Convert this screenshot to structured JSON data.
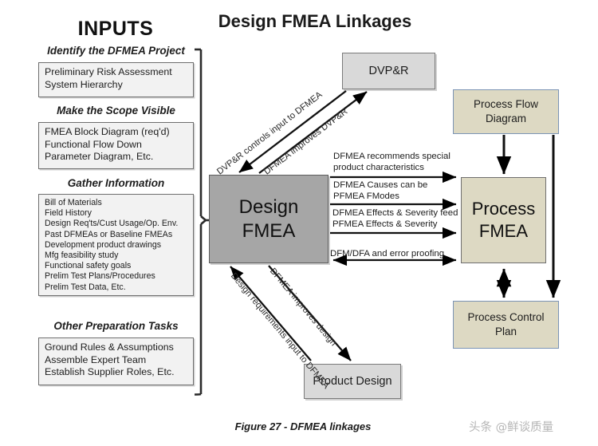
{
  "titles": {
    "inputs": "INPUTS",
    "diagram": "Design FMEA Linkages"
  },
  "input_groups": [
    {
      "header": "Identify the DFMEA Project",
      "items": [
        "Preliminary Risk Assessment",
        "System Hierarchy"
      ]
    },
    {
      "header": "Make the Scope Visible",
      "items": [
        "FMEA Block Diagram (req'd)",
        "Functional Flow Down",
        "Parameter Diagram, Etc."
      ]
    },
    {
      "header": "Gather Information",
      "items": [
        "Bill of Materials",
        "Field History",
        "Design Req'ts/Cust Usage/Op. Env.",
        "Past DFMEAs or Baseline FMEAs",
        "Development product drawings",
        "Mfg feasibility study",
        "Functional safety goals",
        "Prelim Test Plans/Procedures",
        "Prelim Test Data, Etc."
      ]
    },
    {
      "header": "Other Preparation Tasks",
      "items": [
        "Ground Rules & Assumptions",
        "Assemble Expert Team",
        "Establish Supplier Roles, Etc."
      ]
    }
  ],
  "nodes": {
    "design_fmea": "Design\nFMEA",
    "design_fmea_line1": "Design",
    "design_fmea_line2": "FMEA",
    "dvpr": "DVP&R",
    "product_design": "Product Design",
    "process_flow_line1": "Process Flow",
    "process_flow_line2": "Diagram",
    "process_fmea_line1": "Process",
    "process_fmea_line2": "FMEA",
    "process_control_line1": "Process Control",
    "process_control_line2": "Plan"
  },
  "arrow_labels": {
    "dvpr_to_dfmea": "DVP&R controls input to DFMEA",
    "dfmea_to_dvpr": "DFMEA improves DVP&R",
    "design_req_to_dfmea": "Design requirements input to DFMEA",
    "dfmea_improves_design": "DFMEA improves design",
    "mid_1_line1": "DFMEA recommends special",
    "mid_1_line2": "product characteristics",
    "mid_2_line1": "DFMEA Causes can be",
    "mid_2_line2": "PFMEA FModes",
    "mid_3_line1": "DFMEA Effects & Severity feed",
    "mid_3_line2": "PFMEA Effects & Severity",
    "mid_4": "DFM/DFA and error proofing"
  },
  "caption": "Figure 27 - DFMEA linkages",
  "watermark": "头条 @鲜谈质量",
  "colors": {
    "design_fmea_fill": "#a6a6a6",
    "gray_node_fill": "#d9d9d9",
    "process_fill": "#ddd9c3",
    "process_border": "#7b94b5",
    "input_box_fill": "#f2f2f2",
    "arrow": "#000000"
  }
}
